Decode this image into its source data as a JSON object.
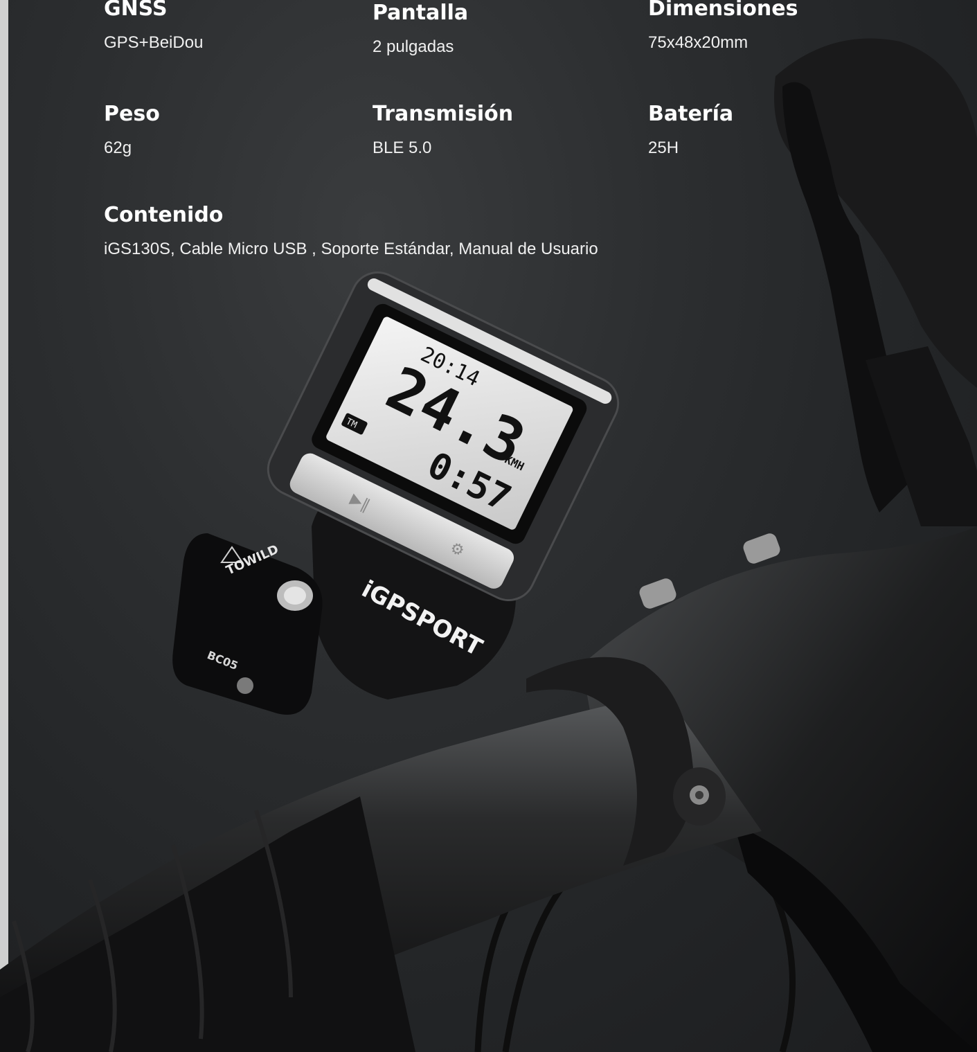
{
  "specs": [
    {
      "label": "GNSS",
      "value": "GPS+BeiDou"
    },
    {
      "label": "Pantalla",
      "value": "2 pulgadas"
    },
    {
      "label": "Dimensiones",
      "value": "75x48x20mm"
    },
    {
      "label": "Peso",
      "value": "62g"
    },
    {
      "label": "Transmisión",
      "value": "BLE 5.0"
    },
    {
      "label": "Batería",
      "value": "25H"
    }
  ],
  "contents": {
    "label": "Contenido",
    "value": "iGS130S, Cable Micro USB , Soporte Estándar, Manual de Usuario"
  },
  "device_screen": {
    "time": "20:14",
    "speed": "24.3",
    "speed_unit": "KMH",
    "mode": "TM",
    "timer": "0:57"
  },
  "brands": {
    "mount": "iGPSPORT",
    "light": "TOWILD",
    "light_model": "BC05"
  },
  "colors": {
    "background": "#2a2c2e",
    "text": "#ffffff"
  }
}
